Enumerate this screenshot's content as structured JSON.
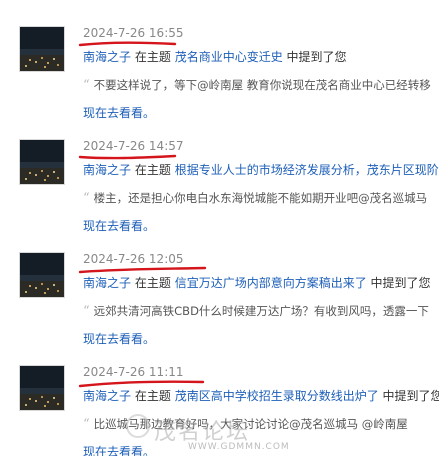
{
  "colors": {
    "link": "#1d5fb8",
    "date": "#888888",
    "underline_annotation": "#d4151b"
  },
  "entries": [
    {
      "date": "2024-7-26 16:55",
      "user": "南海之子",
      "in_thread": "在主题",
      "thread_title": "茂名商业中心变迁史",
      "mentioned": "中提到了您",
      "quote": "不要这样说了，等下@岭南屋 教育你说现在茂名商业中心已经转移",
      "go_link": "现在去看看。"
    },
    {
      "date": "2024-7-26 14:57",
      "user": "南海之子",
      "in_thread": "在主题",
      "thread_title": "根据专业人士的市场经济发展分析，茂东片区现阶段",
      "mentioned": "",
      "quote": "楼主，还是担心你电白水东海悦城能不能如期开业吧@茂名巡城马",
      "go_link": "现在去看看。"
    },
    {
      "date": "2024-7-26 12:05",
      "user": "南海之子",
      "in_thread": "在主题",
      "thread_title": "信宜万达广场内部意向方案稿出来了",
      "mentioned": "中提到了您",
      "quote": "远郊共清河高铁CBD什么时候建万达广场？有收到风吗，透露一下",
      "go_link": "现在去看看。"
    },
    {
      "date": "2024-7-26 11:11",
      "user": "南海之子",
      "in_thread": "在主题",
      "thread_title": "茂南区高中学校招生录取分数线出炉了",
      "mentioned": "中提到了您",
      "quote": "比巡城马那边教育好吗，大家讨论讨论@茂名巡城马 @岭南屋",
      "go_link": "现在去看看。"
    }
  ],
  "watermark": {
    "text_cn": "茂名论坛",
    "text_en": "WWW.GDMMN.COM"
  }
}
